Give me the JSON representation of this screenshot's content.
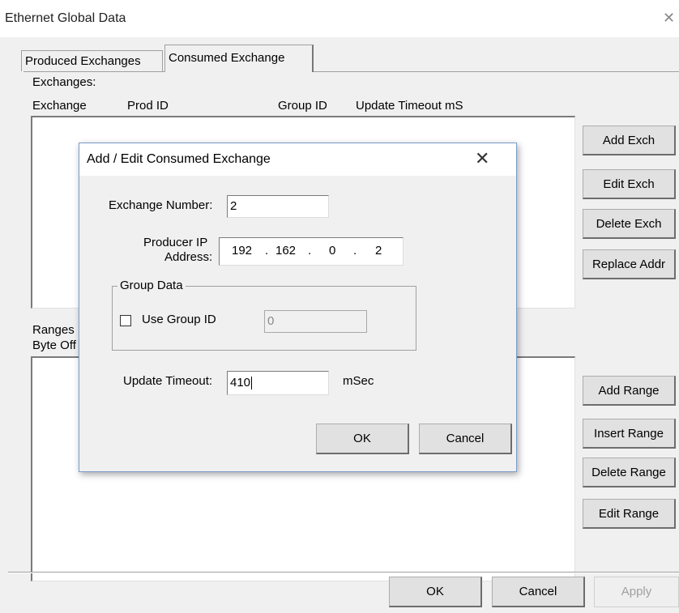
{
  "window": {
    "title": "Ethernet Global Data",
    "close_glyph": "✕",
    "tabs": [
      {
        "label": "Produced Exchanges"
      },
      {
        "label": "Consumed Exchange"
      }
    ],
    "exchanges_label": "Exchanges:",
    "columns": [
      "Exchange",
      "Prod ID",
      "Group ID",
      "Update Timeout mS"
    ],
    "exchange_buttons": [
      "Add Exch",
      "Edit Exch",
      "Delete Exch",
      "Replace Addr"
    ],
    "ranges_label": "Ranges",
    "ranges_col": "Byte Off",
    "range_buttons": [
      "Add Range",
      "Insert Range",
      "Delete Range",
      "Edit Range"
    ],
    "footer_buttons": {
      "ok": "OK",
      "cancel": "Cancel",
      "apply": "Apply"
    }
  },
  "dialog": {
    "title": "Add / Edit Consumed Exchange",
    "close_glyph": "✕",
    "exchange_number_label": "Exchange Number:",
    "exchange_number_value": "2",
    "producer_ip_label_1": "Producer IP",
    "producer_ip_label_2": "Address:",
    "ip_octets": [
      "192",
      "162",
      "0",
      "2"
    ],
    "ip_dot": ".",
    "group_data_legend": "Group Data",
    "use_group_id_label": "Use Group ID",
    "use_group_id_checked": false,
    "group_id_value": "0",
    "update_timeout_label": "Update Timeout:",
    "update_timeout_value": "410",
    "update_timeout_unit": "mSec",
    "ok_label": "OK",
    "cancel_label": "Cancel"
  }
}
